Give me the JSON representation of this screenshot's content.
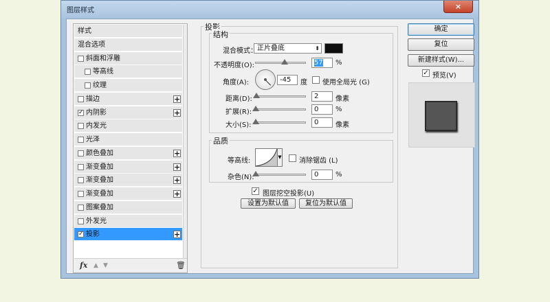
{
  "window": {
    "title": "图层样式",
    "close_icon": "×"
  },
  "style_list": {
    "items": [
      {
        "label": "样式",
        "has_checkbox": false,
        "indent": false,
        "checked": false,
        "has_plus": false,
        "selected": false
      },
      {
        "label": "混合选项",
        "has_checkbox": false,
        "indent": false,
        "checked": false,
        "has_plus": false,
        "selected": false
      },
      {
        "label": "斜面和浮雕",
        "has_checkbox": true,
        "indent": false,
        "checked": false,
        "has_plus": false,
        "selected": false
      },
      {
        "label": "等高线",
        "has_checkbox": true,
        "indent": true,
        "checked": false,
        "has_plus": false,
        "selected": false
      },
      {
        "label": "纹理",
        "has_checkbox": true,
        "indent": true,
        "checked": false,
        "has_plus": false,
        "selected": false
      },
      {
        "label": "描边",
        "has_checkbox": true,
        "indent": false,
        "checked": false,
        "has_plus": true,
        "selected": false
      },
      {
        "label": "内阴影",
        "has_checkbox": true,
        "indent": false,
        "checked": true,
        "has_plus": true,
        "selected": false
      },
      {
        "label": "内发光",
        "has_checkbox": true,
        "indent": false,
        "checked": false,
        "has_plus": false,
        "selected": false
      },
      {
        "label": "光泽",
        "has_checkbox": true,
        "indent": false,
        "checked": false,
        "has_plus": false,
        "selected": false
      },
      {
        "label": "颜色叠加",
        "has_checkbox": true,
        "indent": false,
        "checked": false,
        "has_plus": true,
        "selected": false
      },
      {
        "label": "渐变叠加",
        "has_checkbox": true,
        "indent": false,
        "checked": false,
        "has_plus": true,
        "selected": false
      },
      {
        "label": "渐变叠加",
        "has_checkbox": true,
        "indent": false,
        "checked": false,
        "has_plus": true,
        "selected": false
      },
      {
        "label": "渐变叠加",
        "has_checkbox": true,
        "indent": false,
        "checked": false,
        "has_plus": true,
        "selected": false
      },
      {
        "label": "图案叠加",
        "has_checkbox": true,
        "indent": false,
        "checked": false,
        "has_plus": false,
        "selected": false
      },
      {
        "label": "外发光",
        "has_checkbox": true,
        "indent": false,
        "checked": false,
        "has_plus": false,
        "selected": false
      },
      {
        "label": "投影",
        "has_checkbox": true,
        "indent": false,
        "checked": true,
        "has_plus": true,
        "selected": true
      }
    ],
    "footer": {
      "fx_label": "fx",
      "up_icon": "▲",
      "down_icon": "▼",
      "trash_icon": "🗑"
    },
    "plus_glyph": "+",
    "check_glyph": "✓"
  },
  "drop_shadow": {
    "title": "投影",
    "structure": {
      "title": "结构",
      "blend_mode_label": "混合模式：",
      "blend_mode_value": "正片叠底",
      "shadow_color": "#0e0e0e",
      "opacity_label": "不透明度(O):",
      "opacity_value": "57",
      "opacity_level": 0.57,
      "percent": "%",
      "angle_label": "角度(A):",
      "angle_value": "-45",
      "degree_unit": "度",
      "global_light_label": "使用全局光 (G)",
      "global_light_checked": false,
      "distance_label": "距离(D):",
      "distance_value": "2",
      "distance_level": 0.02,
      "size_unit": "像素",
      "spread_label": "扩展(R):",
      "spread_value": "0",
      "spread_level": 0.0,
      "size_label": "大小(S):",
      "size_value": "0",
      "size_level": 0.0
    },
    "quality": {
      "title": "品质",
      "contour_label": "等高线:",
      "anti_alias_label": "消除锯齿 (L)",
      "anti_alias_checked": false,
      "noise_label": "杂色(N):",
      "noise_value": "0",
      "noise_level": 0.0
    },
    "knockout_label": "图层挖空投影(U)",
    "knockout_checked": true,
    "set_default_label": "设置为默认值",
    "reset_default_label": "复位为默认值"
  },
  "actions": {
    "ok_label": "确定",
    "reset_label": "复位",
    "new_style_label": "新建样式(W)...",
    "preview_label": "预览(V)",
    "preview_checked": true
  }
}
